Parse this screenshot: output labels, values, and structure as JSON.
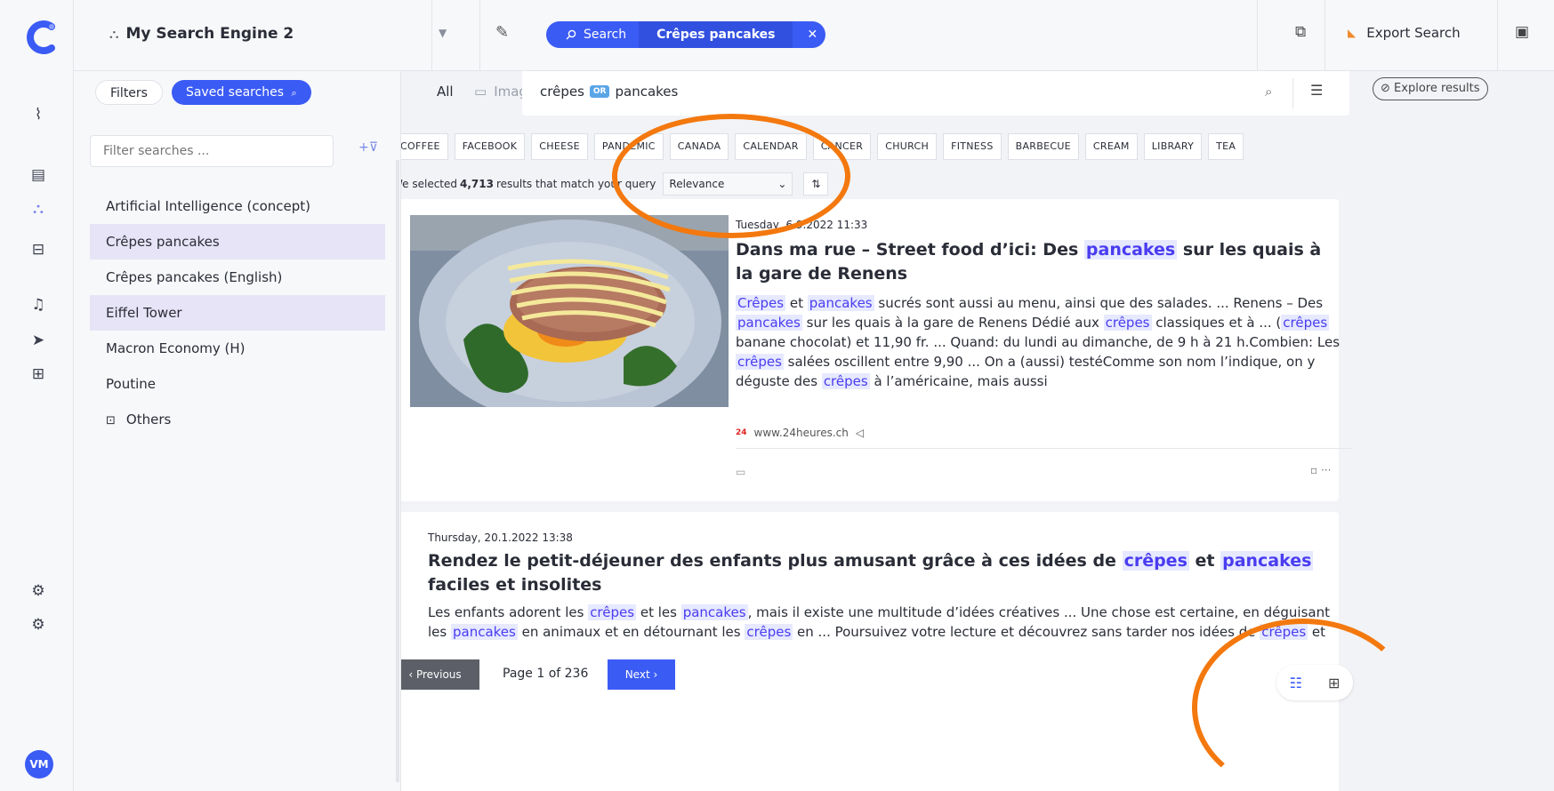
{
  "rail": {
    "avatar_initials": "VM",
    "items": [
      "activity-icon",
      "layers-icon",
      "search-engine-icon",
      "archive-icon",
      "bell-icon",
      "send-icon",
      "grid-icon",
      "settings-icon",
      "settings-alt-icon"
    ]
  },
  "header": {
    "engine_name": "My Search Engine 2",
    "search_pill_label": "Search",
    "search_pill_term": "Crêpes pancakes",
    "export_label": "Export Search"
  },
  "sidebar": {
    "tab_filters": "Filters",
    "tab_saved": "Saved searches",
    "filter_placeholder": "Filter searches ...",
    "items": [
      {
        "label": "Artificial Intelligence (concept)"
      },
      {
        "label": "Crêpes pancakes"
      },
      {
        "label": "Crêpes pancakes (English)"
      },
      {
        "label": "Eiffel Tower"
      },
      {
        "label": "Macron Economy (H)"
      },
      {
        "label": "Poutine"
      },
      {
        "label": "Others"
      }
    ]
  },
  "main": {
    "type_all": "All",
    "type_images": "Images",
    "query_term_1": "crêpes",
    "query_operator": "OR",
    "query_term_2": "pancakes",
    "explore_label": "Explore results",
    "chips": [
      "COFFEE",
      "FACEBOOK",
      "CHEESE",
      "PANDEMIC",
      "CANADA",
      "CALENDAR",
      "CANCER",
      "CHURCH",
      "FITNESS",
      "BARBECUE",
      "CREAM",
      "LIBRARY",
      "TEA"
    ],
    "count_prefix": "We selected",
    "count_value": "4,713",
    "count_suffix": "results that match your query",
    "sort_value": "Relevance",
    "results": [
      {
        "date": "Tuesday, 6.9.2022 11:33",
        "title_a": "Dans ma rue – Street food d’ici: Des ",
        "title_hl": "pancakes",
        "title_b": " sur les quais à la gare de Renens",
        "source": "www.24heures.ch",
        "source_badge": "24"
      },
      {
        "date": "Thursday, 20.1.2022 13:38",
        "title_a": "Rendez le petit-déjeuner des enfants plus amusant grâce à ces idées de ",
        "title_hl1": "crêpes",
        "title_mid": " et ",
        "title_hl2": "pancakes",
        "title_b": " faciles et insolites"
      }
    ],
    "hl_crepes": "crêpes",
    "hl_crepes_cap": "Crêpes",
    "hl_pancakes": "pancakes",
    "r1_s1": " et ",
    "r1_s2": " sucrés sont aussi au menu, ainsi que des salades. ... Renens – Des ",
    "r1_s3": " sur les quais à la gare de Renens Dédié aux ",
    "r1_s4": " classiques et à ... (",
    "r1_s5": " banane chocolat) et 11,90 fr. ... Quand: du lundi au dimanche, de 9 h à 21 h.Combien: Les ",
    "r1_s6": " salées oscillent entre 9,90 ... On a (aussi) testéComme son nom l’indique, on y déguste des ",
    "r1_s7": " à l’américaine, mais aussi",
    "r2_s1": "Les enfants adorent les ",
    "r2_s2": " et les ",
    "r2_s3": ", mais il existe une multitude d’idées créatives ... Une chose est certaine, en déguisant les ",
    "r2_s4": " en animaux et en détournant les ",
    "r2_s5": " en ... Poursuivez votre lecture et découvrez sans tarder nos idées de ",
    "r2_s6": " et"
  },
  "pager": {
    "prev_label": "‹ Previous",
    "page_info": "Page 1 of 236",
    "next_label": "Next ›"
  },
  "colors": {
    "accent": "#3b5bf5",
    "highlight_text": "#4a3cf0",
    "annotation": "#f3780e",
    "selected_row": "#e6e4f6"
  }
}
